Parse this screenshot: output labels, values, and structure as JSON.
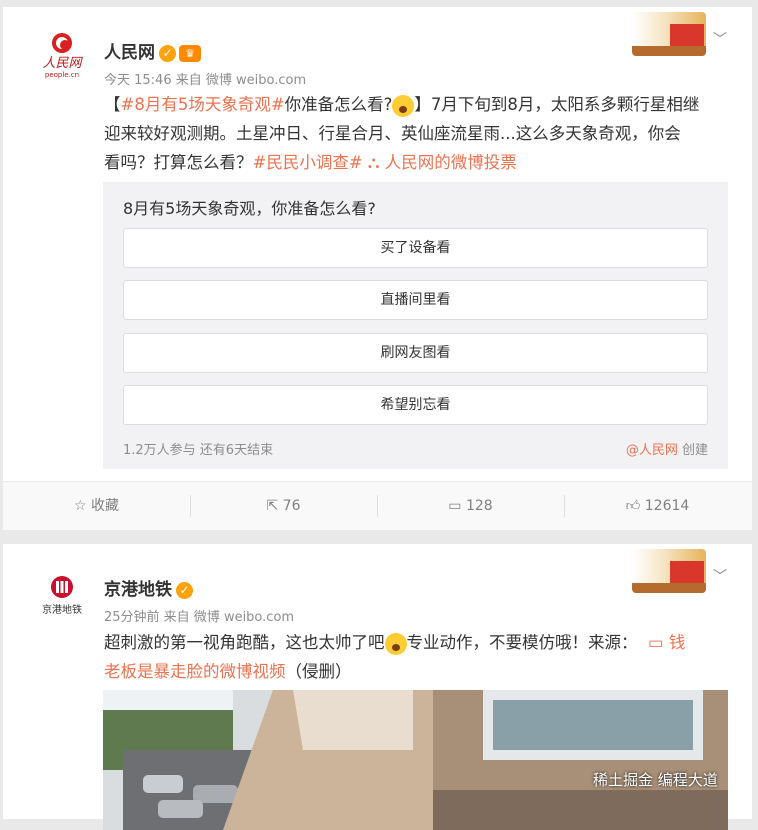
{
  "post1": {
    "name": "人民网",
    "logo_text": "人民网",
    "logo_subtext": "people.cn",
    "meta": "今天 15:46 来自 微博 weibo.com",
    "text_l1_a": "【",
    "text_l1_tag": "#8月有5场天象奇观#",
    "text_l1_b": "你准备怎么看?",
    "text_l1_c": "】7月下旬到8月，太阳系多颗行星相继",
    "text_l2": "迎来较好观测期。土星冲日、行星合月、英仙座流星雨...这么多天象奇观，你会",
    "text_l3_a": "看吗？打算怎么看？",
    "text_l3_tag": "#民民小调查#",
    "text_l3_link": "人民网的微博投票",
    "poll": {
      "title": "8月有5场天象奇观，你准备怎么看?",
      "options": [
        "买了设备看",
        "直播间里看",
        "刷网友图看",
        "希望别忘看"
      ],
      "stat": "1.2万人参与 还有6天结束",
      "source_link": "@人民网",
      "source_suffix": "创建"
    },
    "actions": {
      "fav": "收藏",
      "repost": "76",
      "comment": "128",
      "like": "12614"
    }
  },
  "post2": {
    "name": "京港地铁",
    "logo_text": "京港地铁",
    "meta": "25分钟前 来自 微博 weibo.com",
    "text_l1_a": "超刺激的第一视角跑酷，这也太帅了吧",
    "text_l1_b": "专业动作，不要模仿哦！来源：",
    "text_l1_link": "钱",
    "text_l2_link": "老板是暴走脸的微博视频",
    "text_l2_b": "（侵删）"
  },
  "watermark": "稀土掘金  编程大道",
  "colors": {
    "accent": "#eb7350",
    "verified": "#ffa20b"
  }
}
